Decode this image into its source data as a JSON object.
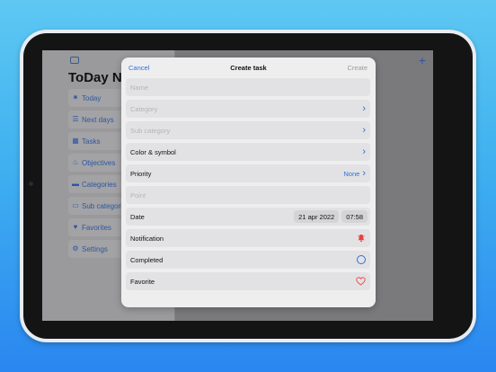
{
  "sidebar": {
    "title": "ToDay No",
    "items": [
      {
        "label": "Today",
        "icon": "sun-icon"
      },
      {
        "label": "Next days",
        "icon": "list-icon"
      },
      {
        "label": "Tasks",
        "icon": "calendar-icon"
      },
      {
        "label": "Objectives",
        "icon": "flame-icon"
      },
      {
        "label": "Categories",
        "icon": "folder-icon"
      },
      {
        "label": "Sub categorie",
        "icon": "tray-icon"
      },
      {
        "label": "Favorites",
        "icon": "heart-icon"
      },
      {
        "label": "Settings",
        "icon": "gear-icon"
      }
    ]
  },
  "modal": {
    "cancel_label": "Cancel",
    "title": "Create task",
    "create_label": "Create",
    "name_placeholder": "Name",
    "category_placeholder": "Category",
    "subcategory_placeholder": "Sub category",
    "color_label": "Color & symbol",
    "priority_label": "Priority",
    "priority_value": "None",
    "points_placeholder": "Point",
    "date_label": "Date",
    "date_value": "21 apr 2022",
    "time_value": "07:58",
    "notification_label": "Notification",
    "completed_label": "Completed",
    "favorite_label": "Favorite"
  },
  "colors": {
    "accent": "#2f6fd8",
    "bell": "#e8413f",
    "heart": "#e8413f"
  }
}
